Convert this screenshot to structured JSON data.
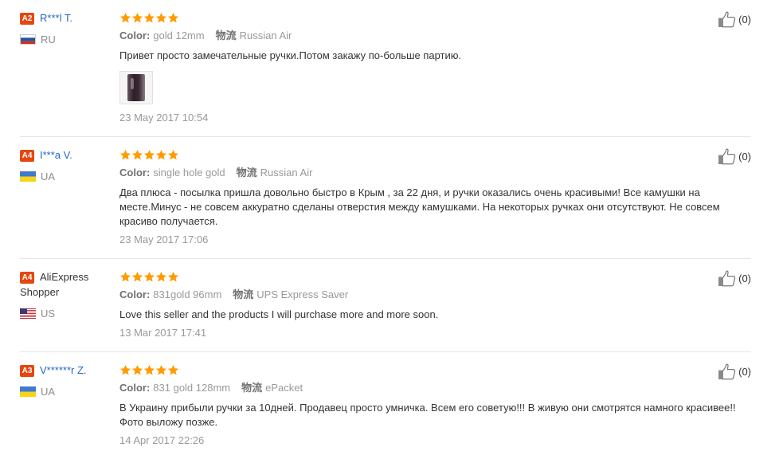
{
  "labels": {
    "color": "Color:",
    "logistics": "物流"
  },
  "colors": {
    "link": "#2168c9",
    "badge": "#e5470e",
    "star": "#ff9b00",
    "divider": "#e6e6e6",
    "muted": "#999999",
    "label": "#707070"
  },
  "icons": {
    "helpful": "thumbs-up-icon",
    "star": "star-icon",
    "photo": "review-photo-thumbnail"
  },
  "reviews": [
    {
      "badge": "A2",
      "name": "R***l T.",
      "country": "RU",
      "flag_icon": "flag-ru-icon",
      "rating": 5,
      "color_value": "gold 12mm",
      "logistics_value": "Russian Air",
      "text": "Привет просто замечательные ручки.Потом закажу по-больше партию.",
      "photo_icon": "review-photo-thumbnail",
      "date": "23 May 2017 10:54",
      "helpful": "(0)"
    },
    {
      "badge": "A4",
      "name": "I***a V.",
      "country": "UA",
      "flag_icon": "flag-ua-icon",
      "rating": 5,
      "color_value": "single hole gold",
      "logistics_value": "Russian Air",
      "text": "Два плюса - посылка пришла довольно быстро в Крым , за 22 дня, и ручки оказались очень красивыми! Все камушки на месте.Минус - не совсем аккуратно сделаны отверстия между камушками. На некоторых ручках они отсутствуют. Не совсем красиво получается.",
      "date": "23 May 2017 17:06",
      "helpful": "(0)"
    },
    {
      "badge": "A4",
      "name": "AliExpress Shopper",
      "country": "US",
      "flag_icon": "flag-us-icon",
      "rating": 5,
      "color_value": "831gold 96mm",
      "logistics_value": "UPS Express Saver",
      "text": "Love this seller and the products I will purchase more and more soon.",
      "date": "13 Mar 2017 17:41",
      "helpful": "(0)"
    },
    {
      "badge": "A3",
      "name": "V******r Z.",
      "country": "UA",
      "flag_icon": "flag-ua-icon",
      "rating": 5,
      "color_value": "831 gold 128mm",
      "logistics_value": "ePacket",
      "text": "В Украину прибыли ручки за 10дней. Продавец просто умничка. Всем его советую!!! В живую они смотрятся намного красивее!! Фото выложу позже.",
      "date": "14 Apr 2017 22:26",
      "helpful": "(0)"
    }
  ]
}
